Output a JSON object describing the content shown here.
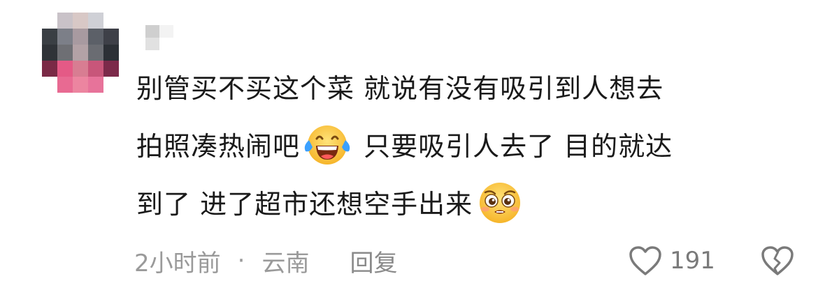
{
  "comment": {
    "lines": [
      "别管买不买这个菜  就说有没有吸引到人想去",
      "拍照凑热闹吧",
      " 只要吸引人去了  目的就达",
      "到了 进了超市还想空手出来"
    ],
    "emojis": [
      "laughing-crying-emoji",
      "pleading-emoji"
    ],
    "time": "2小时前",
    "separator": "·",
    "location": "云南",
    "reply_label": "回复",
    "like_count": "191",
    "icons": [
      "heart-outline-icon",
      "broken-heart-icon"
    ]
  }
}
